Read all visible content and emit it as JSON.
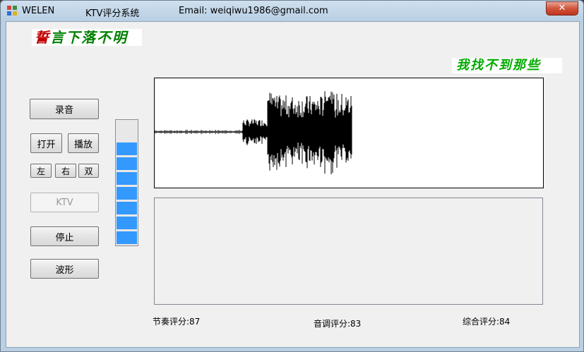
{
  "window": {
    "app_name": "WELEN",
    "title": "KTV评分系统",
    "email": "Email: weiqiwu1986@gmail.com",
    "close_glyph": "✕"
  },
  "banners": {
    "left": [
      {
        "ch": "誓",
        "color": "#c00000"
      },
      {
        "ch": "言",
        "color": "#008000"
      },
      {
        "ch": "下",
        "color": "#008000"
      },
      {
        "ch": "落",
        "color": "#008000"
      },
      {
        "ch": "不",
        "color": "#008000"
      },
      {
        "ch": "明",
        "color": "#008000"
      }
    ],
    "right": [
      {
        "ch": "我",
        "color": "#00aa00"
      },
      {
        "ch": "找",
        "color": "#00aa00"
      },
      {
        "ch": "不",
        "color": "#00aa00"
      },
      {
        "ch": "到",
        "color": "#00aa00"
      },
      {
        "ch": "那",
        "color": "#00aa00"
      },
      {
        "ch": "些",
        "color": "#00aa00"
      }
    ]
  },
  "buttons": {
    "record": "录音",
    "open": "打开",
    "play": "播放",
    "left": "左",
    "right": "右",
    "both": "双",
    "ktv": "KTV",
    "stop": "停止",
    "waveform": "波形"
  },
  "level_meter": {
    "segments_total": 9,
    "segments_lit": 7
  },
  "scores": {
    "rhythm": "节奏评分:87",
    "pitch": "音调评分:83",
    "overall": "综合评分:84"
  }
}
